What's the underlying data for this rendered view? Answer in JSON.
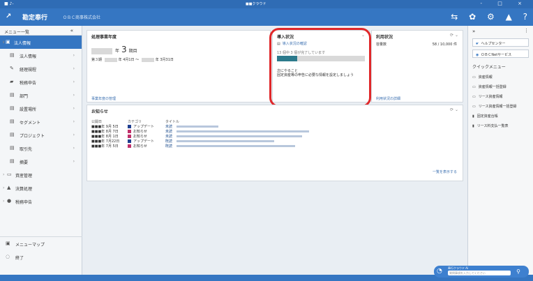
{
  "titlebar": {
    "left": "■ ♪-",
    "center": "■■クラウド",
    "right": "- □ ×"
  },
  "header": {
    "logo": "↗",
    "brand": "勘定奉行",
    "company": "ＯＢＣ商事株式会社",
    "icons": [
      "export-icon",
      "gear-icon",
      "settings-icon",
      "user-icon",
      "help-icon"
    ],
    "icon_glyphs": [
      "⇆",
      "✿",
      "⚙",
      "▲",
      "?"
    ]
  },
  "sidebar": {
    "header": "メニュー一覧",
    "collapse": "«",
    "items": [
      {
        "label": "法人情報",
        "active": true,
        "group": true,
        "icon": "▣",
        "caret": "∨"
      },
      {
        "label": "法人情報",
        "icon": "▤",
        "arrow": "›"
      },
      {
        "label": "経理規程",
        "icon": "✎",
        "arrow": "›"
      },
      {
        "label": "税務申告",
        "icon": "▰",
        "arrow": "›"
      },
      {
        "label": "部門",
        "icon": "▤",
        "arrow": "›"
      },
      {
        "label": "設置場所",
        "icon": "▤",
        "arrow": "›"
      },
      {
        "label": "セグメント",
        "icon": "▤",
        "arrow": "›"
      },
      {
        "label": "プロジェクト",
        "icon": "▤",
        "arrow": "›"
      },
      {
        "label": "取引先",
        "icon": "▤",
        "arrow": "›"
      },
      {
        "label": "摘要",
        "icon": "▤",
        "arrow": "›"
      },
      {
        "label": "資産管理",
        "icon": "▭",
        "group": true,
        "caret": "›"
      },
      {
        "label": "決算処理",
        "icon": "▲",
        "group": true,
        "caret": "›"
      },
      {
        "label": "税務申告",
        "icon": "●",
        "group": true,
        "caret": "›"
      }
    ],
    "bottom": [
      {
        "label": "メニューマップ",
        "icon": "▣"
      },
      {
        "label": "終了",
        "icon": "◌"
      }
    ]
  },
  "fiscal": {
    "title": "処理事業年度",
    "ctl": "",
    "term_suffix": "年",
    "term_num": "3",
    "term_unit": "期目",
    "period_prefix": "第３期",
    "period_mid": "年 4月1日 ～",
    "period_end": "年 3月31日",
    "link": "事業年度の管理"
  },
  "intro": {
    "title": "導入状況",
    "ctl": "⌄",
    "link": "導入状況の確認",
    "progress_text": "13 個中 3 個が完了しています",
    "progress": 0.23,
    "next_label": "次にやること",
    "next_text": "固定資産等の申告に必要な情報を設定しましょう"
  },
  "usage": {
    "title": "利用状況",
    "ctl": "⟳ ⌄",
    "line_label": "容量数",
    "line_value": "58 / 10,000 件",
    "link": "利用状況の詳細"
  },
  "news": {
    "title": "お知らせ",
    "ctl": "⟳ ⌄",
    "head": {
      "date": "公開日",
      "cat": "カテゴリ",
      "title": "タイトル"
    },
    "rows": [
      {
        "date": "■■■年 9月 5日",
        "cat": "アップデート",
        "color": "#1f3f8f",
        "tag": "未読",
        "w": 60
      },
      {
        "date": "■■■年 8月 7日",
        "cat": "お知らせ",
        "color": "#c0306a",
        "tag": "未読",
        "w": 190
      },
      {
        "date": "■■■年 8月 1日",
        "cat": "お知らせ",
        "color": "#c0306a",
        "tag": "未読",
        "w": 180
      },
      {
        "date": "■■■年 7月22日",
        "cat": "アップデート",
        "color": "#1f3f8f",
        "tag": "既読",
        "w": 140
      },
      {
        "date": "■■■年 7月 5日",
        "cat": "お知らせ",
        "color": "#c0306a",
        "tag": "既読",
        "w": 170
      }
    ],
    "more": "一覧を表示する"
  },
  "rightpanel": {
    "head": "»",
    "vdots": "⋮",
    "buttons": [
      {
        "label": "ヘルプセンター",
        "icon": "☛"
      },
      {
        "label": "ＯＢＣNetサービス",
        "icon": "◉"
      }
    ],
    "quick_title": "クイックメニュー",
    "quick_items": [
      {
        "label": "資産情報",
        "icon": "▭"
      },
      {
        "label": "資産情報一括登録",
        "icon": "▭"
      },
      {
        "label": "リース資産情報",
        "icon": "▭"
      },
      {
        "label": "リース資産情報一括登録",
        "icon": "▭"
      },
      {
        "label": "固定資産台帳",
        "icon": "▮"
      },
      {
        "label": "リース料支払一覧表",
        "icon": "▮"
      }
    ]
  },
  "bottom_widget": {
    "label": "奉行クラウド Ai",
    "placeholder": "質問事項を入力してください",
    "search_icon": "⚲",
    "chat_icon": "◔"
  }
}
